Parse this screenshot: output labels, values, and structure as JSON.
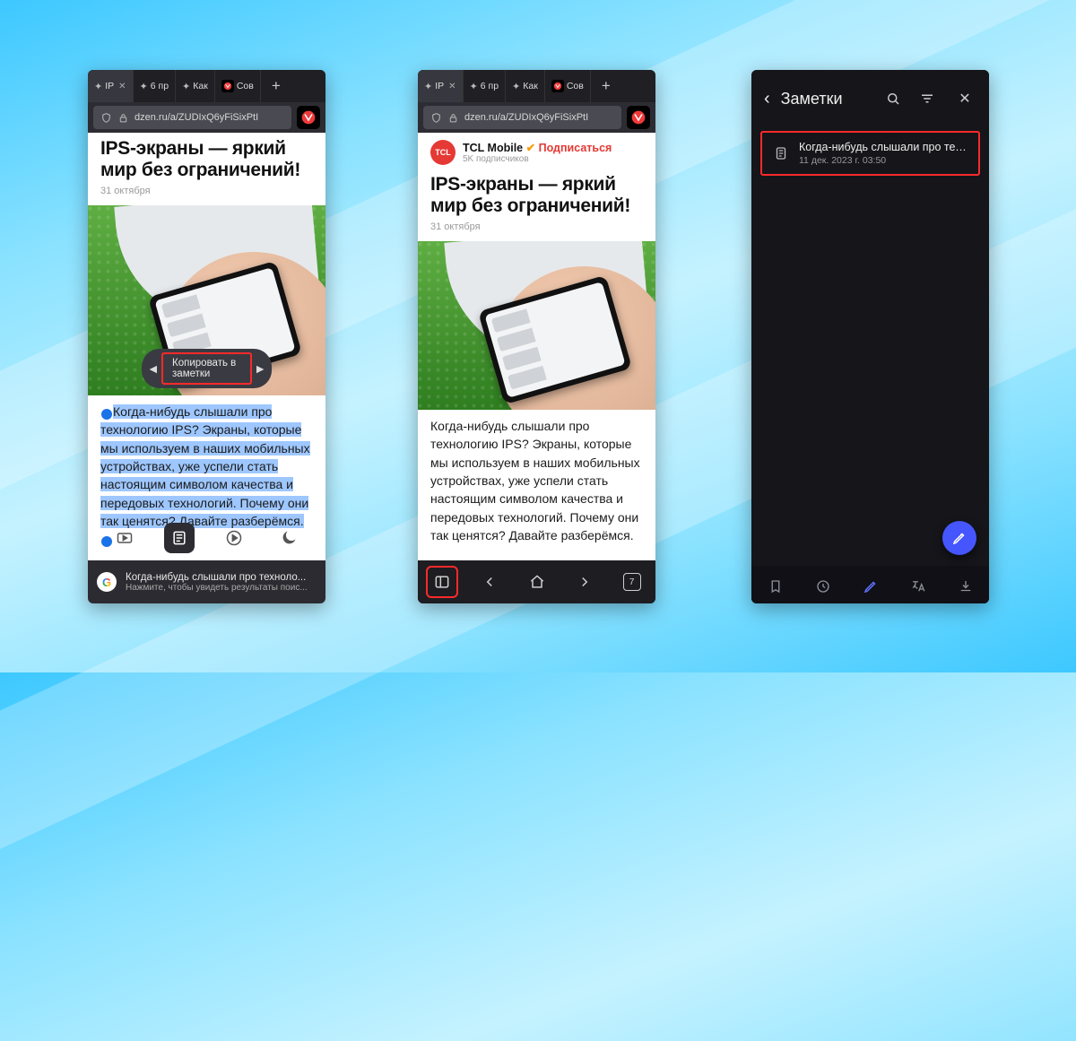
{
  "tabs": {
    "t1": "IP",
    "t2": "6 пр",
    "t3": "Как",
    "t4": "Сов"
  },
  "url": "dzen.ru/a/ZUDIxQ6yFiSixPtI",
  "article": {
    "headline": "IPS-экраны — яркий мир без ограничений!",
    "date": "31 октября",
    "author_name": "TCL Mobile",
    "subscribe": "Подписаться",
    "subs": "5K подписчиков",
    "avatar_label": "TCL",
    "body": "Когда-нибудь слышали про технологию IPS? Экраны, которые мы используем в наших мобильных устройствах, уже успели стать настоящим символом качества и передовых технологий. Почему они так ценятся? Давайте разберёмся."
  },
  "selection_popup": "Копировать в заметки",
  "search_card": {
    "line1": "Когда-нибудь слышали про техноло...",
    "line2": "Нажмите, чтобы увидеть результаты поис..."
  },
  "tab_count": "7",
  "notes": {
    "title": "Заметки",
    "item_title": "Когда-нибудь слышали про техно...",
    "item_date": "11 дек. 2023 г. 03:50"
  }
}
